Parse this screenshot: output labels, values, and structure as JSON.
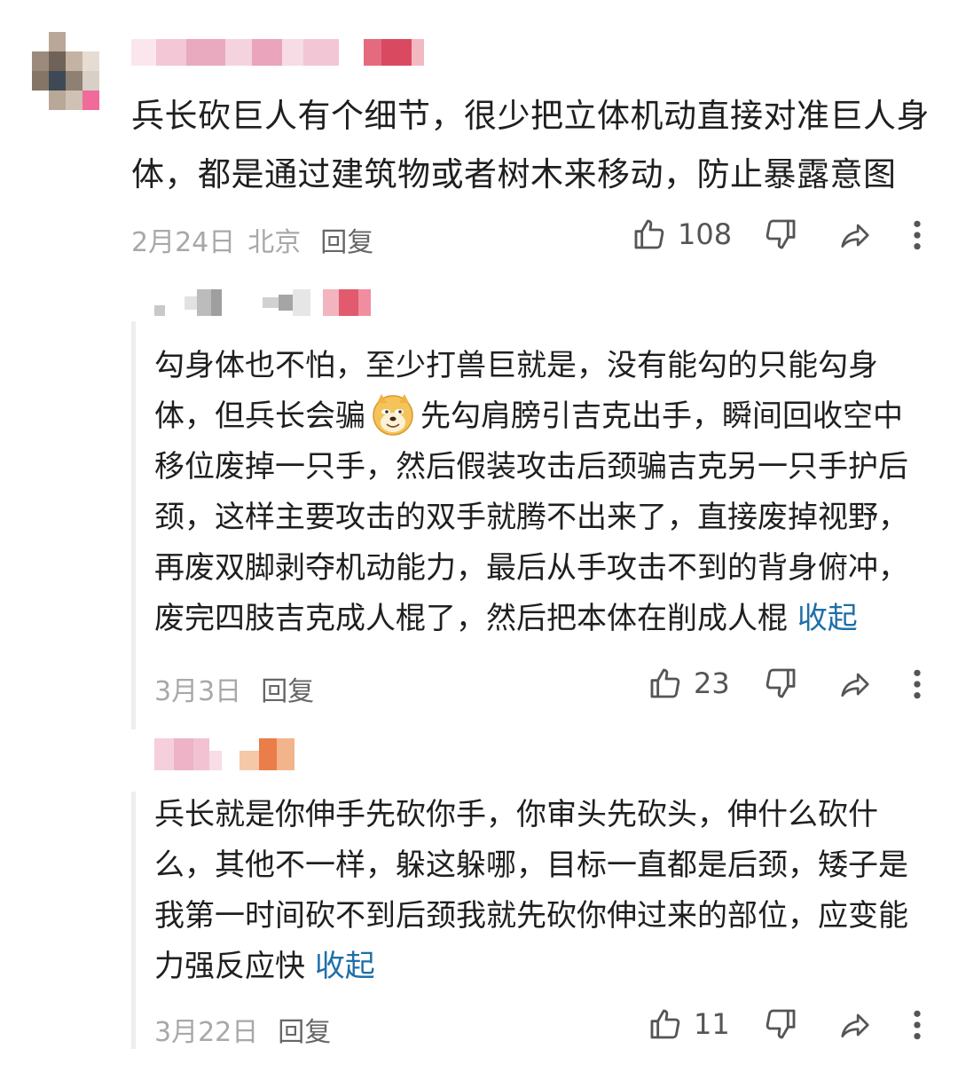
{
  "top_comment": {
    "text_line1": "兵长砍巨人有个细节，很少把立体机动直接对准巨人身",
    "text_line2": "体，都是通过建筑物或者树木来移动，防止暴露意图",
    "date": "2月24日",
    "location": "北京",
    "reply_label": "回复",
    "like_count": "108"
  },
  "replies": [
    {
      "lines": [
        "勾身体也不怕，至少打兽巨就是，没有能勾的只能勾身",
        "体，但兵长会骗",
        "先勾肩膀引吉克出手，瞬间回收空中",
        "移位废掉一只手，然后假装攻击后颈骗吉克另一只手护后",
        "颈，这样主要攻击的双手就腾不出来了，直接废掉视野，",
        "再废双脚剥夺机动能力，最后从手攻击不到的背身俯冲，",
        "废完四肢吉克成人棍了，然后把本体在削成人棍"
      ],
      "collapse_label": "收起",
      "date": "3月3日",
      "reply_label": "回复",
      "like_count": "23"
    },
    {
      "lines": [
        "兵长就是你伸手先砍你手，你审头先砍头，伸什么砍什",
        "么，其他不一样，躲这躲哪，目标一直都是后颈，矮子是",
        "我第一时间砍不到后颈我就先砍你伸过来的部位，应变能",
        "力强反应快"
      ],
      "collapse_label": "收起",
      "date": "3月22日",
      "reply_label": "回复",
      "like_count": "11"
    }
  ],
  "icons": {
    "like": "thumbs-up-icon",
    "dislike": "thumbs-down-icon",
    "share": "share-arrow-icon",
    "more": "more-vertical-icon",
    "emoji": "doge-emoji-icon"
  },
  "colors": {
    "text": "#1f1f1f",
    "meta": "#a8a8a8",
    "link": "#1e6fa8",
    "icon": "#555555"
  }
}
